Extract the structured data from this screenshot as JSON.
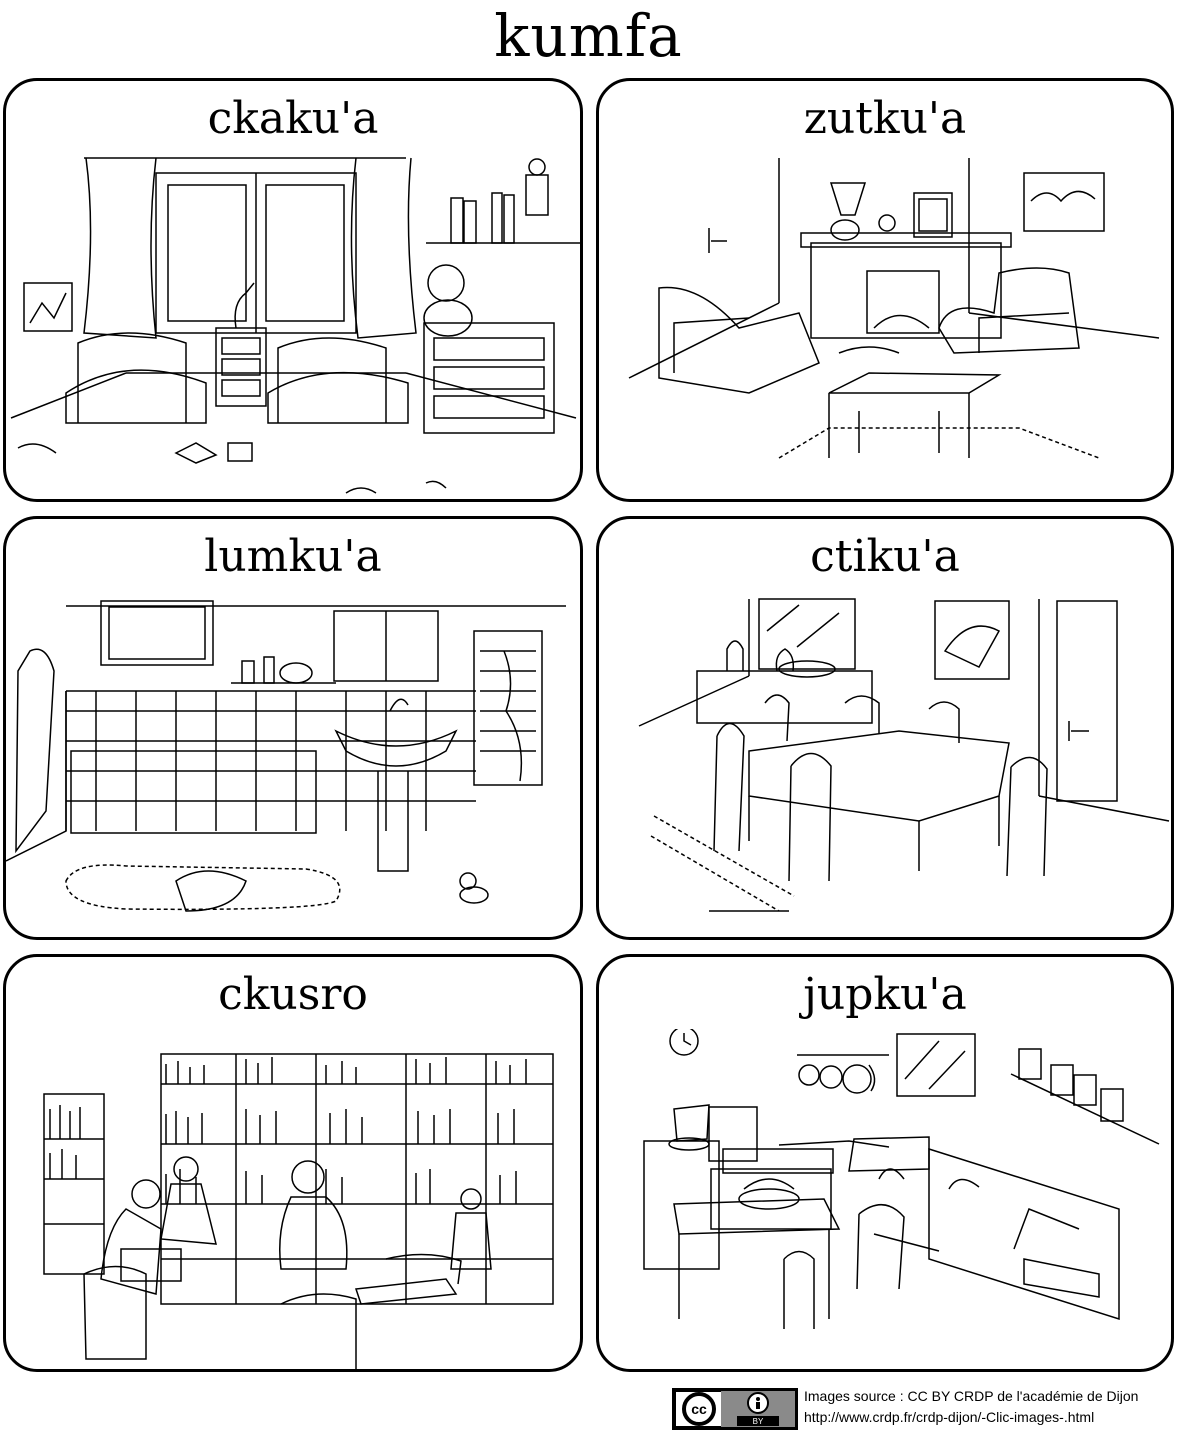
{
  "page": {
    "title": "kumfa"
  },
  "rooms": [
    {
      "label": "ckaku'a"
    },
    {
      "label": "zutku'a"
    },
    {
      "label": "lumku'a"
    },
    {
      "label": "ctiku'a"
    },
    {
      "label": "ckusro"
    },
    {
      "label": "jupku'a"
    }
  ],
  "footer": {
    "license_badge": {
      "left": "cc",
      "right": "BY",
      "icon": "attribution-icon"
    },
    "credit_line1": "Images source : CC BY CRDP de l'académie de Dijon",
    "credit_line2": "http://www.crdp.fr/crdp-dijon/-Clic-images-.html"
  }
}
